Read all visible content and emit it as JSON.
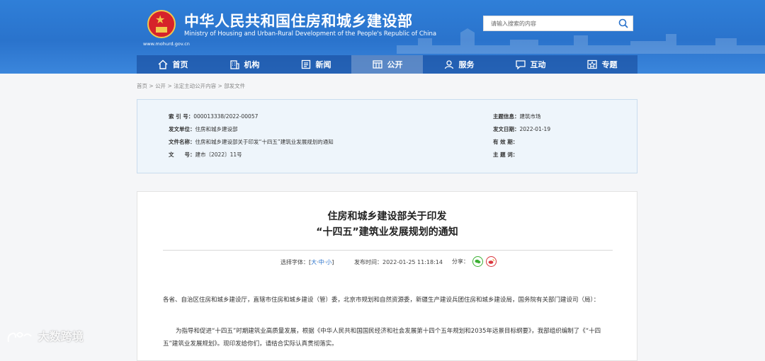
{
  "header": {
    "title_cn": "中华人民共和国住房和城乡建设部",
    "title_en": "Ministry of Housing and Urban-Rural Development of the People's Republic of China",
    "domain": "www.mohurd.gov.cn",
    "search_placeholder": "请输入搜索的内容"
  },
  "nav": {
    "items": [
      {
        "label": "首页",
        "icon": "home-icon"
      },
      {
        "label": "机构",
        "icon": "building-icon"
      },
      {
        "label": "新闻",
        "icon": "news-icon"
      },
      {
        "label": "公开",
        "icon": "open-icon",
        "active": true
      },
      {
        "label": "服务",
        "icon": "service-icon"
      },
      {
        "label": "互动",
        "icon": "chat-icon"
      },
      {
        "label": "专题",
        "icon": "topic-icon"
      }
    ]
  },
  "breadcrumb": [
    "首页",
    "公开",
    "法定主动公开内容",
    "部发文件"
  ],
  "info": {
    "index_label": "索 引 号：",
    "index_value": "000013338/2022-00057",
    "issuer_label": "发文单位：",
    "issuer_value": "住房和城乡建设部",
    "name_label": "文件名称：",
    "name_value": "住房和城乡建设部关于印发“十四五”建筑业发展规划的通知",
    "docno_label": "文　　号：",
    "docno_value": "建市〔2022〕11号",
    "topic_label": "主题信息：",
    "topic_value": "建筑市场",
    "date_label": "发文日期：",
    "date_value": "2022-01-19",
    "valid_label": "有 效 期：",
    "valid_value": "",
    "theme_label": "主 题 词：",
    "theme_value": ""
  },
  "document": {
    "title_line1": "住房和城乡建设部关于印发",
    "title_line2": "“十四五”建筑业发展规划的通知",
    "font_label": "选择字体：",
    "font_open": "[",
    "font_large": "大",
    "font_mid": "中",
    "font_small": "小",
    "font_close": "]",
    "font_sep": "·",
    "publish_label": "发布时间：",
    "publish_time": "2022-01-25 11:18:14",
    "share_label": "分享：",
    "para1": "各省、自治区住房和城乡建设厅，直辖市住房和城乡建设（管）委，北京市规划和自然资源委，新疆生产建设兵团住房和城乡建设局，国务院有关部门建设司（局）：",
    "para2": "为指导和促进“十四五”时期建筑业高质量发展，根据《中华人民共和国国民经济和社会发展第十四个五年规划和2035年远景目标纲要》，我部组织编制了《“十四五”建筑业发展规划》。现印发给你们，请结合实际认真贯彻落实。"
  },
  "watermark": "大数跨境",
  "colors": {
    "header_blue": "#2a73cc",
    "info_bg": "#eef5fb",
    "link_blue": "#2a73cc"
  }
}
